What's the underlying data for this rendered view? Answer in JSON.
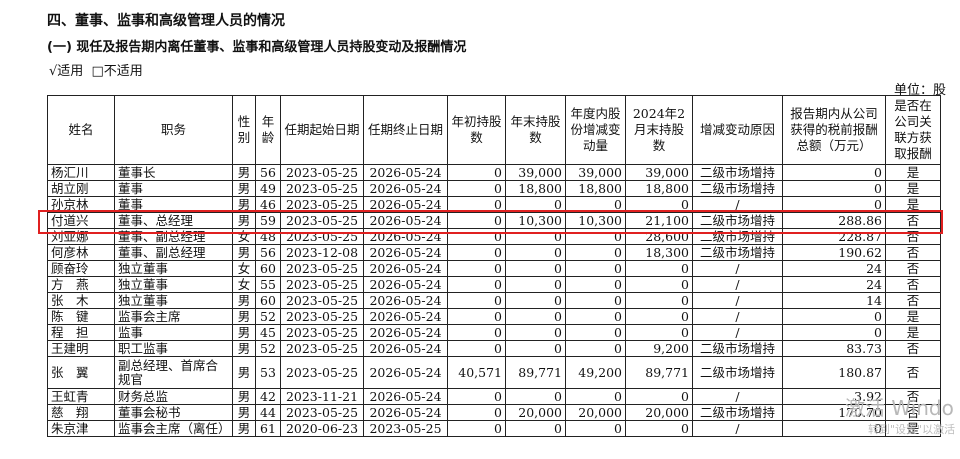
{
  "section_title": "四、董事、监事和高级管理人员的情况",
  "subsection_title": "(一)  现任及报告期内离任董事、监事和高级管理人员持股变动及报酬情况",
  "options": {
    "checked": "√适用",
    "unchecked": "□不适用"
  },
  "unit_label": "单位：股",
  "table": {
    "headers": [
      "姓名",
      "职务",
      "性别",
      "年龄",
      "任期起始日期",
      "任期终止日期",
      "年初持股数",
      "年末持股数",
      "年度内股份增减变动量",
      "2024年2月末持股数",
      "增减变动原因",
      "报告期内从公司获得的税前报酬总额（万元）",
      "是否在公司关联方获取报酬"
    ],
    "rows": [
      [
        "杨汇川",
        "董事长",
        "男",
        "56",
        "2023-05-25",
        "2026-05-24",
        "0",
        "39,000",
        "39,000",
        "39,000",
        "二级市场增持",
        "0",
        "是"
      ],
      [
        "胡立刚",
        "董事",
        "男",
        "49",
        "2023-05-25",
        "2026-05-24",
        "0",
        "18,800",
        "18,800",
        "18,800",
        "二级市场增持",
        "0",
        "是"
      ],
      [
        "孙京林",
        "董事",
        "男",
        "46",
        "2023-05-25",
        "2026-05-24",
        "0",
        "0",
        "0",
        "0",
        "/",
        "0",
        "是"
      ],
      [
        "付道兴",
        "董事、总经理",
        "男",
        "59",
        "2023-05-25",
        "2026-05-24",
        "0",
        "10,300",
        "10,300",
        "21,100",
        "二级市场增持",
        "288.86",
        "否"
      ],
      [
        "刘亚娜",
        "董事、副总经理",
        "女",
        "48",
        "2023-05-25",
        "2026-05-24",
        "0",
        "0",
        "0",
        "28,600",
        "二级市场增持",
        "228.87",
        "否"
      ],
      [
        "何彦林",
        "董事、副总经理",
        "男",
        "56",
        "2023-12-08",
        "2026-05-24",
        "0",
        "0",
        "0",
        "18,300",
        "二级市场增持",
        "190.62",
        "否"
      ],
      [
        "顾奋玲",
        "独立董事",
        "女",
        "60",
        "2023-05-25",
        "2026-05-24",
        "0",
        "0",
        "0",
        "0",
        "/",
        "24",
        "否"
      ],
      [
        "方　燕",
        "独立董事",
        "女",
        "55",
        "2023-05-25",
        "2026-05-24",
        "0",
        "0",
        "0",
        "0",
        "/",
        "24",
        "否"
      ],
      [
        "张　木",
        "独立董事",
        "男",
        "60",
        "2023-05-25",
        "2026-05-24",
        "0",
        "0",
        "0",
        "0",
        "/",
        "14",
        "否"
      ],
      [
        "陈　键",
        "监事会主席",
        "男",
        "52",
        "2023-05-25",
        "2026-05-24",
        "0",
        "0",
        "0",
        "0",
        "/",
        "0",
        "是"
      ],
      [
        "程　担",
        "监事",
        "男",
        "45",
        "2023-05-25",
        "2026-05-24",
        "0",
        "0",
        "0",
        "0",
        "/",
        "0",
        "是"
      ],
      [
        "王建明",
        "职工监事",
        "男",
        "52",
        "2023-05-25",
        "2026-05-24",
        "0",
        "0",
        "0",
        "9,200",
        "二级市场增持",
        "83.73",
        "否"
      ],
      [
        "张　翼",
        "副总经理、首席合规官",
        "男",
        "53",
        "2023-05-25",
        "2026-05-24",
        "40,571",
        "89,771",
        "49,200",
        "89,771",
        "二级市场增持",
        "180.87",
        "否"
      ],
      [
        "王虹青",
        "财务总监",
        "男",
        "42",
        "2023-11-21",
        "2026-05-24",
        "0",
        "0",
        "0",
        "0",
        "/",
        "3.92",
        "否"
      ],
      [
        "慈　翔",
        "董事会秘书",
        "男",
        "44",
        "2023-05-25",
        "2026-05-24",
        "0",
        "20,000",
        "20,000",
        "20,000",
        "二级市场增持",
        "170.70",
        "否"
      ],
      [
        "朱京津",
        "监事会主席（离任）",
        "男",
        "61",
        "2020-06-23",
        "2023-05-25",
        "0",
        "0",
        "0",
        "0",
        "/",
        "0",
        "是"
      ]
    ]
  },
  "watermark": {
    "line1": "激活 Windo",
    "line2": "转到\"设置\"以激活"
  },
  "colors": {
    "highlight": "#e02020"
  }
}
